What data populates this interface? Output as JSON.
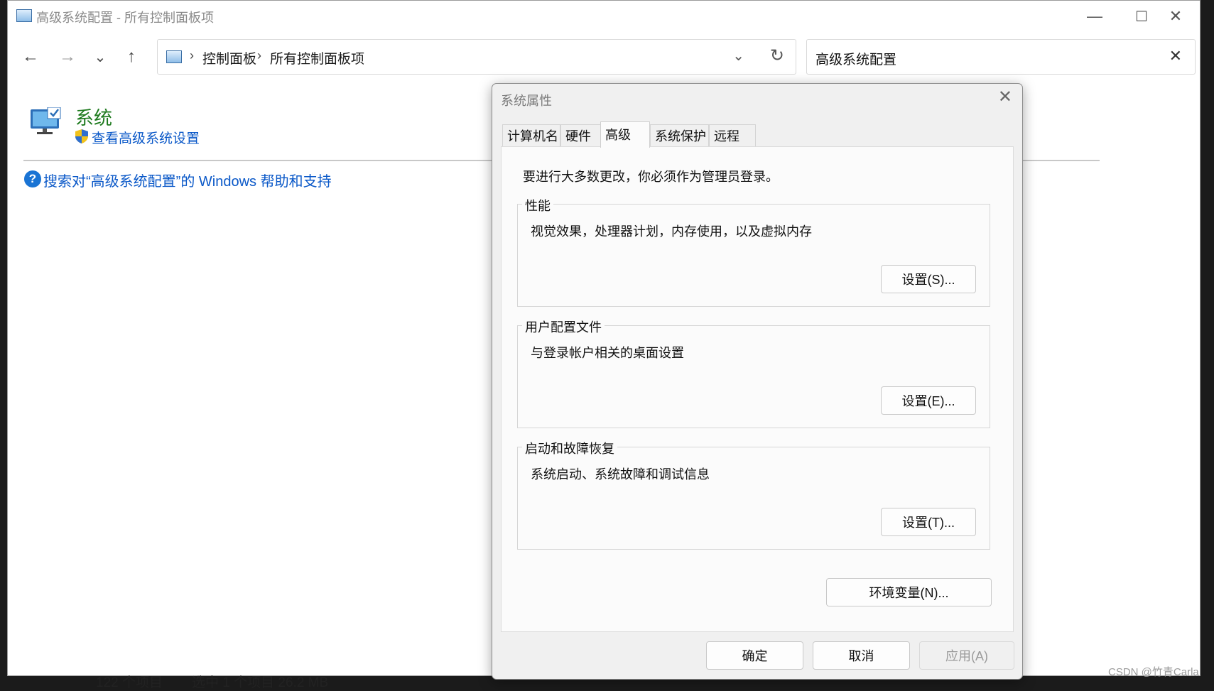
{
  "explorer": {
    "title": "高级系统配置 - 所有控制面板项",
    "window_controls": {
      "minimize": "—",
      "maximize": "☐",
      "close": "✕"
    },
    "nav": {
      "back": "←",
      "forward": "→",
      "recent": "⌄",
      "up": "↑"
    },
    "address": {
      "sep1": "›",
      "crumb1": "控制面板",
      "sep2": "›",
      "crumb2": "所有控制面板项",
      "dropdown": "⌄",
      "refresh": "↻"
    },
    "search": {
      "value": "高级系统配置",
      "clear": "✕"
    },
    "results": {
      "system_title": "系统",
      "system_link": "查看高级系统设置",
      "help_link": "搜索对“高级系统配置”的 Windows 帮助和支持"
    },
    "status_bar": {
      "item_count": "122 个项目",
      "selection": "选中 1 个项目  26.2 MB"
    }
  },
  "dialog": {
    "title": "系统属性",
    "close": "✕",
    "tabs": [
      "计算机名",
      "硬件",
      "高级",
      "系统保护",
      "远程"
    ],
    "active_tab": "高级",
    "admin_note": "要进行大多数更改，你必须作为管理员登录。",
    "groups": [
      {
        "label": "性能",
        "description": "视觉效果，处理器计划，内存使用，以及虚拟内存",
        "button": "设置(S)..."
      },
      {
        "label": "用户配置文件",
        "description": "与登录帐户相关的桌面设置",
        "button": "设置(E)..."
      },
      {
        "label": "启动和故障恢复",
        "description": "系统启动、系统故障和调试信息",
        "button": "设置(T)..."
      }
    ],
    "env_button": "环境变量(N)...",
    "ok_button": "确定",
    "cancel_button": "取消",
    "apply_button": "应用(A)"
  },
  "watermark": "CSDN @竹青Carla",
  "colors": {
    "link": "#0a58c8",
    "system_title": "#1e7a1e",
    "help_icon": "#1a74d4"
  },
  "icons": [
    "control-panel-icon",
    "system-monitor-icon",
    "uac-shield-icon",
    "help-icon"
  ]
}
